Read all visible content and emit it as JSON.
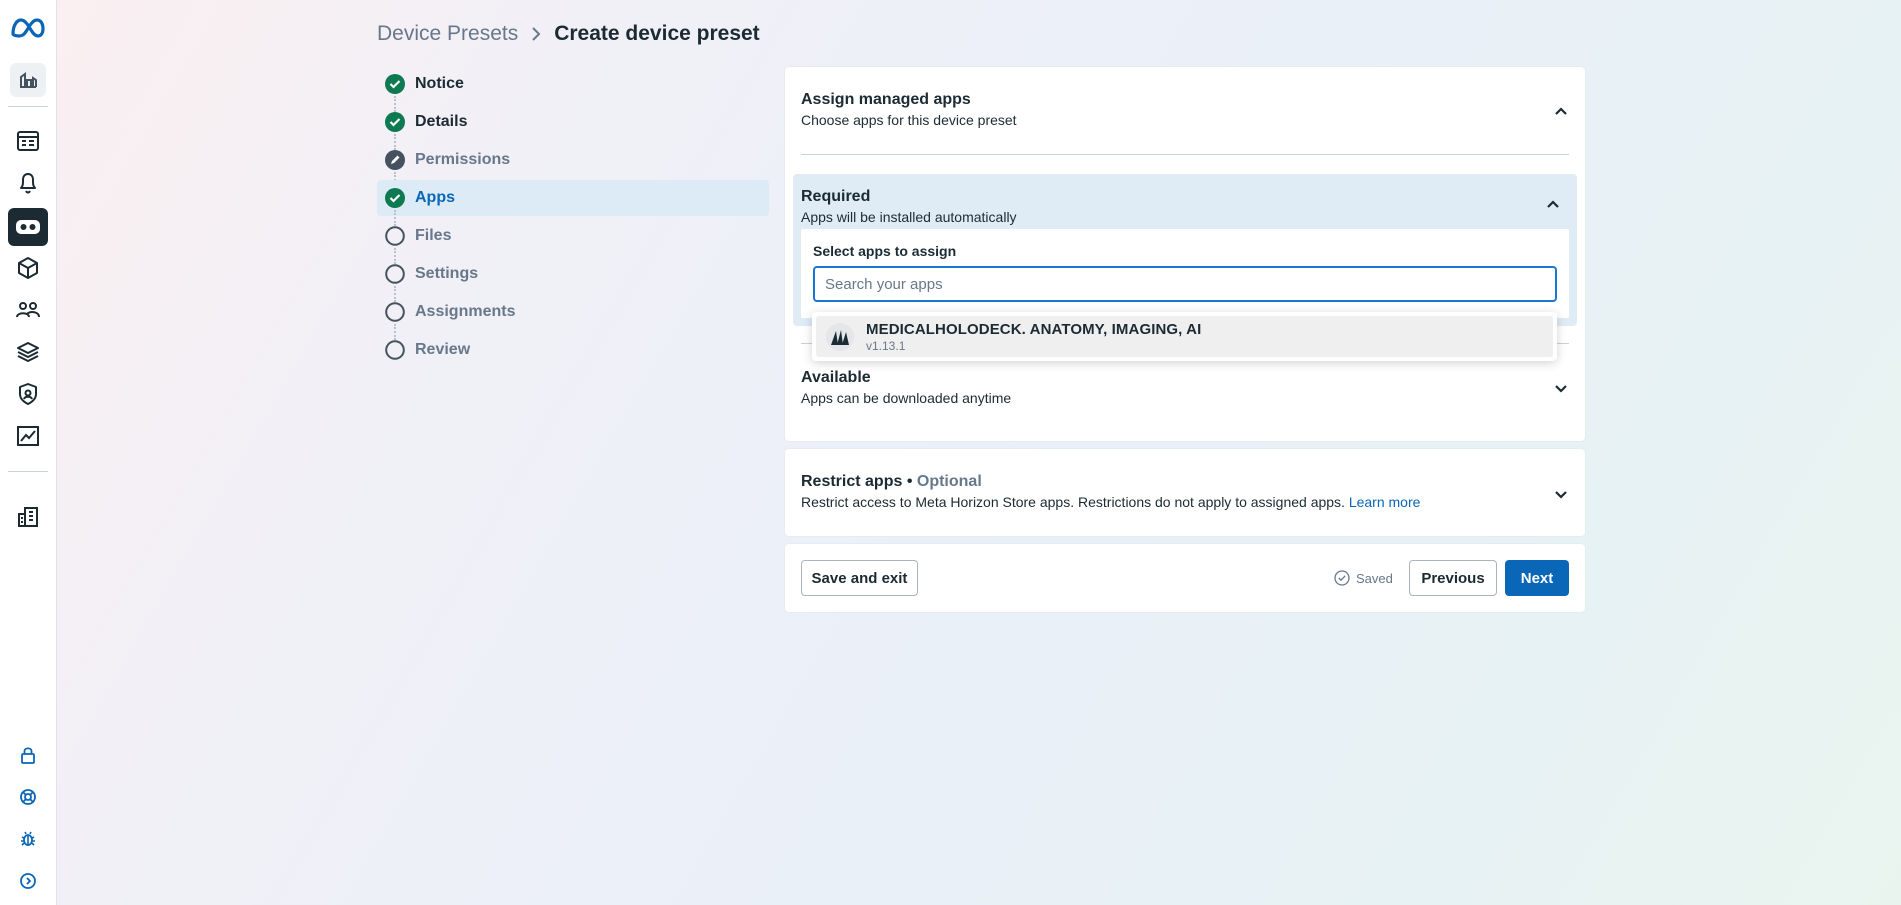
{
  "breadcrumb": {
    "parent": "Device Presets",
    "current": "Create device preset"
  },
  "steps": [
    {
      "label": "Notice",
      "state": "done"
    },
    {
      "label": "Details",
      "state": "done"
    },
    {
      "label": "Permissions",
      "state": "partial"
    },
    {
      "label": "Apps",
      "state": "current"
    },
    {
      "label": "Files",
      "state": "todo"
    },
    {
      "label": "Settings",
      "state": "todo"
    },
    {
      "label": "Assignments",
      "state": "todo"
    },
    {
      "label": "Review",
      "state": "todo"
    }
  ],
  "assign": {
    "title": "Assign managed apps",
    "subtitle": "Choose apps for this device preset"
  },
  "required": {
    "title": "Required",
    "subtitle": "Apps will be installed automatically",
    "select_label": "Select apps to assign",
    "search_placeholder": "Search your apps",
    "search_value": ""
  },
  "dropdown": {
    "items": [
      {
        "name": "MEDICALHOLODECK. ANATOMY, IMAGING, AI",
        "version": "v1.13.1"
      }
    ]
  },
  "available": {
    "title": "Available",
    "subtitle": "Apps can be downloaded anytime"
  },
  "restrict": {
    "title": "Restrict apps",
    "separator": " • ",
    "optional": "Optional",
    "description": "Restrict access to Meta Horizon Store apps. Restrictions do not apply to assigned apps. ",
    "learn_more": "Learn more"
  },
  "footer": {
    "save_exit": "Save and exit",
    "saved": "Saved",
    "previous": "Previous",
    "next": "Next"
  },
  "rail_icons": [
    "meta-logo-icon",
    "organization-icon",
    "dashboard-icon",
    "notifications-icon",
    "headset-icon",
    "apps-cube-icon",
    "users-icon",
    "layers-icon",
    "security-icon",
    "analytics-icon",
    "building-icon",
    "lock-icon",
    "help-icon",
    "bug-icon",
    "expand-icon"
  ],
  "colors": {
    "accent": "#0a66b7",
    "success": "#0d7a52",
    "text": "#1c2b33",
    "muted": "#67788a"
  }
}
